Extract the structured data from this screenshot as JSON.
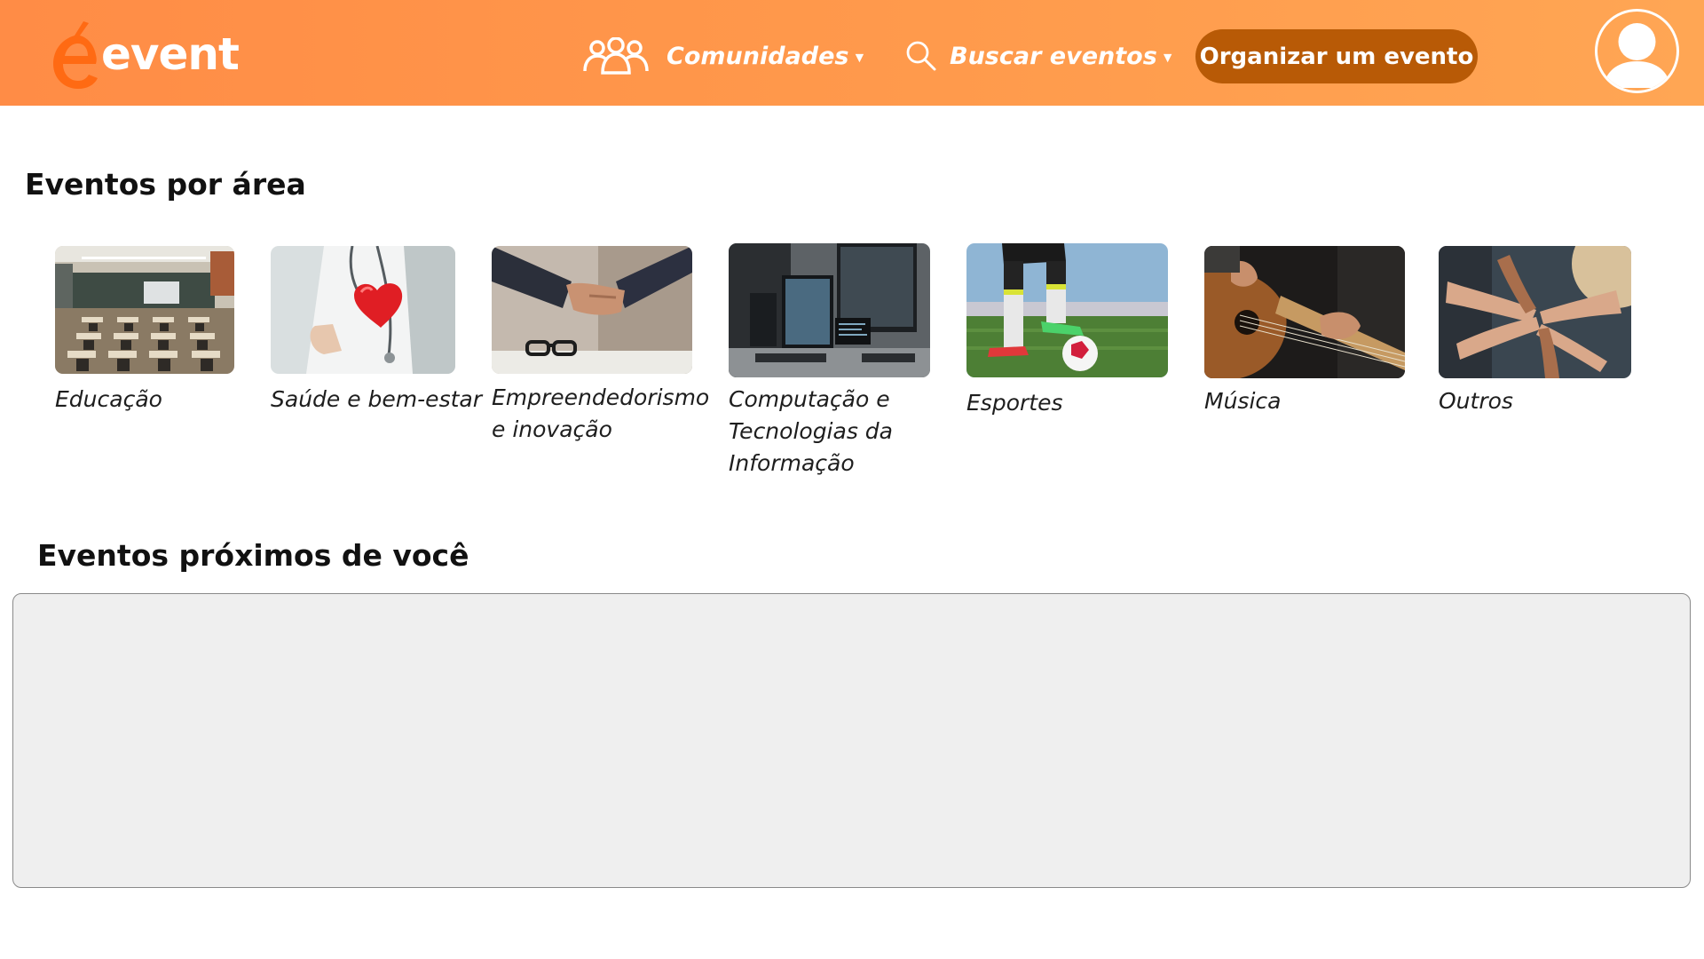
{
  "brand": {
    "logo_text": "event",
    "accent": "#ff9a4c",
    "cta_color": "#b85a06"
  },
  "nav": {
    "communities": {
      "label": "Comunidades",
      "icon": "people-group-icon"
    },
    "search": {
      "label": "Buscar eventos",
      "icon": "search-icon"
    },
    "cta_label": "Organizar um evento",
    "avatar_icon": "user-avatar-icon"
  },
  "sections": {
    "areas_title": "Eventos por área",
    "nearby_title": "Eventos próximos de você"
  },
  "categories": [
    {
      "label": "Educação",
      "image": "classroom"
    },
    {
      "label": "Saúde e bem-estar",
      "image": "doctor-heart"
    },
    {
      "label": "Empreendedorismo e inovação",
      "image": "handshake"
    },
    {
      "label": "Computação e Tecnologias da Informação",
      "image": "computers"
    },
    {
      "label": "Esportes",
      "image": "soccer"
    },
    {
      "label": "Música",
      "image": "guitar"
    },
    {
      "label": "Outros",
      "image": "joined-hands"
    }
  ]
}
